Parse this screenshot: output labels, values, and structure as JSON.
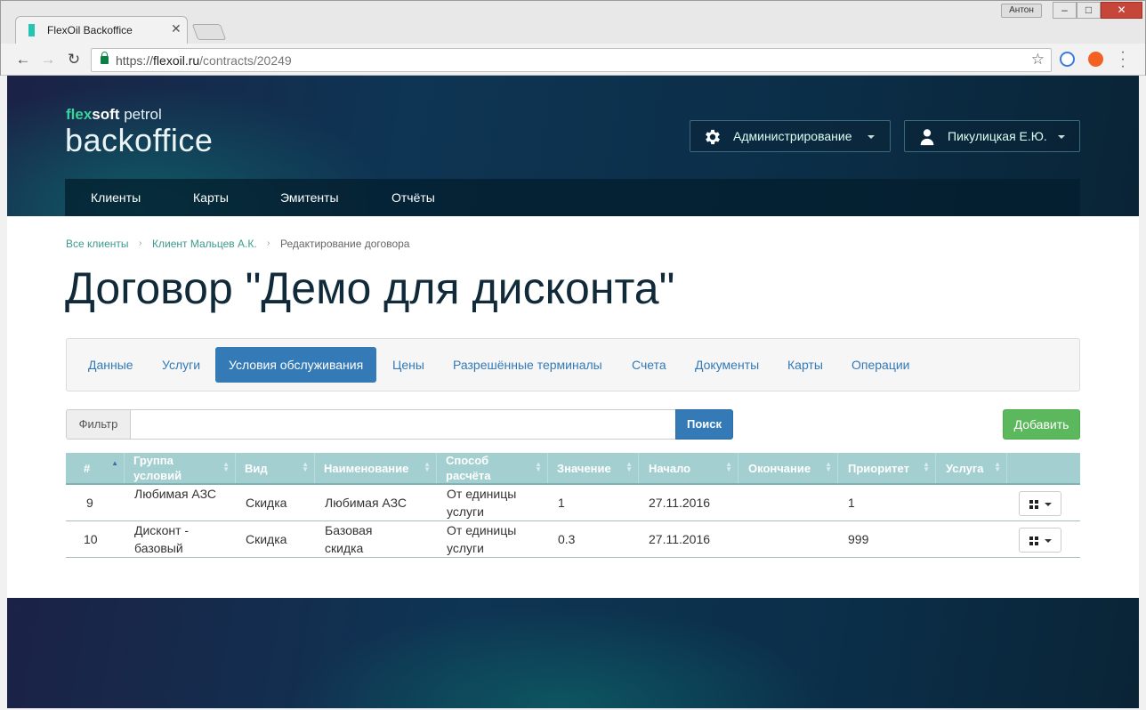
{
  "browser": {
    "tab_title": "FlexOil Backoffice",
    "tab_close": "✕",
    "window_user": "Антон",
    "url_scheme": "https://",
    "url_host": "flexoil.ru",
    "url_path": "/contracts/20249"
  },
  "logo": {
    "flex": "flex",
    "soft": "soft",
    "petrol": " petrol",
    "product": "backoffice"
  },
  "header": {
    "admin_label": "Администрирование",
    "user_label": "Пикулицкая Е.Ю."
  },
  "main_nav": [
    "Клиенты",
    "Карты",
    "Эмитенты",
    "Отчёты"
  ],
  "breadcrumb": {
    "items": [
      "Все клиенты",
      "Клиент Мальцев А.К.",
      "Редактирование договора"
    ],
    "separator": "›"
  },
  "page_title": "Договор \"Демо для дисконта\"",
  "tabs": {
    "items": [
      "Данные",
      "Услуги",
      "Условия обслуживания",
      "Цены",
      "Разрешённые терминалы",
      "Счета",
      "Документы",
      "Карты",
      "Операции"
    ],
    "active": "Условия обслуживания"
  },
  "filter": {
    "label": "Фильтр",
    "value": "",
    "search_label": "Поиск",
    "add_label": "Добавить"
  },
  "table": {
    "columns": [
      "#",
      "Группа условий",
      "Вид",
      "Наименование",
      "Способ расчёта",
      "Значение",
      "Начало",
      "Окончание",
      "Приоритет",
      "Услуга"
    ],
    "sorted_column": "#",
    "rows": [
      {
        "num": "9",
        "group": "Любимая АЗС",
        "kind": "Скидка",
        "name": "Любимая АЗС",
        "method": "От единицы услуги",
        "value": "1",
        "start": "27.11.2016",
        "end": "",
        "priority": "1",
        "service": ""
      },
      {
        "num": "10",
        "group": "Дисконт - базовый",
        "kind": "Скидка",
        "name": "Базовая скидка",
        "method": "От единицы услуги",
        "value": "0.3",
        "start": "27.11.2016",
        "end": "",
        "priority": "999",
        "service": ""
      }
    ]
  },
  "colors": {
    "accent": "#337ab7",
    "success": "#5cb85c",
    "table_header": "#a4cfd1",
    "header_dark": "#0e3554",
    "brand_green": "#38d49b"
  }
}
